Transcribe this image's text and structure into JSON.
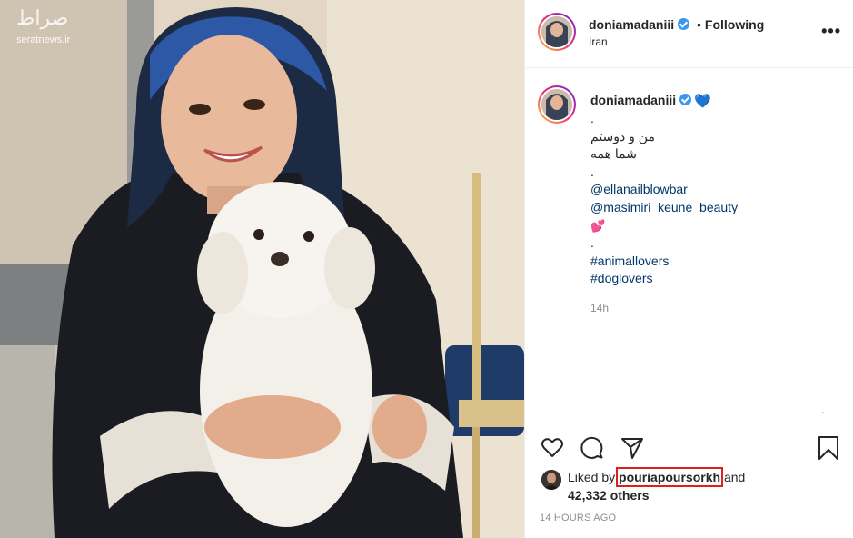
{
  "photo": {
    "watermark_logo": "صراط",
    "watermark_text": "seratnews.ir"
  },
  "header": {
    "username": "doniamadaniii",
    "separator": "•",
    "follow_status": "Following",
    "location": "Iran",
    "more_label": "•••"
  },
  "caption": {
    "username": "doniamadaniii",
    "user_emoji": "💙",
    "lines": [
      {
        "text": ".",
        "kind": "text"
      },
      {
        "text": "من و دوستم",
        "kind": "rtl"
      },
      {
        "text": "شما همه",
        "kind": "rtl"
      },
      {
        "text": ".",
        "kind": "text"
      },
      {
        "text": "@ellanailblowbar",
        "kind": "link"
      },
      {
        "text": "@masimiri_keune_beauty",
        "kind": "link"
      },
      {
        "text": "💕",
        "kind": "emoji"
      },
      {
        "text": ".",
        "kind": "text"
      },
      {
        "text": "#animallovers",
        "kind": "link"
      },
      {
        "text": "#doglovers",
        "kind": "link"
      }
    ],
    "time_ago": "14h"
  },
  "likes": {
    "prefix": "Liked by",
    "liker": "pouriapoursorkh",
    "suffix": "and",
    "others": "42,332 others"
  },
  "timestamp": "14 HOURS AGO",
  "colors": {
    "link": "#00376b",
    "verified": "#3897f0",
    "highlight_box": "#e01e1e",
    "muted": "#8e8e8e"
  }
}
